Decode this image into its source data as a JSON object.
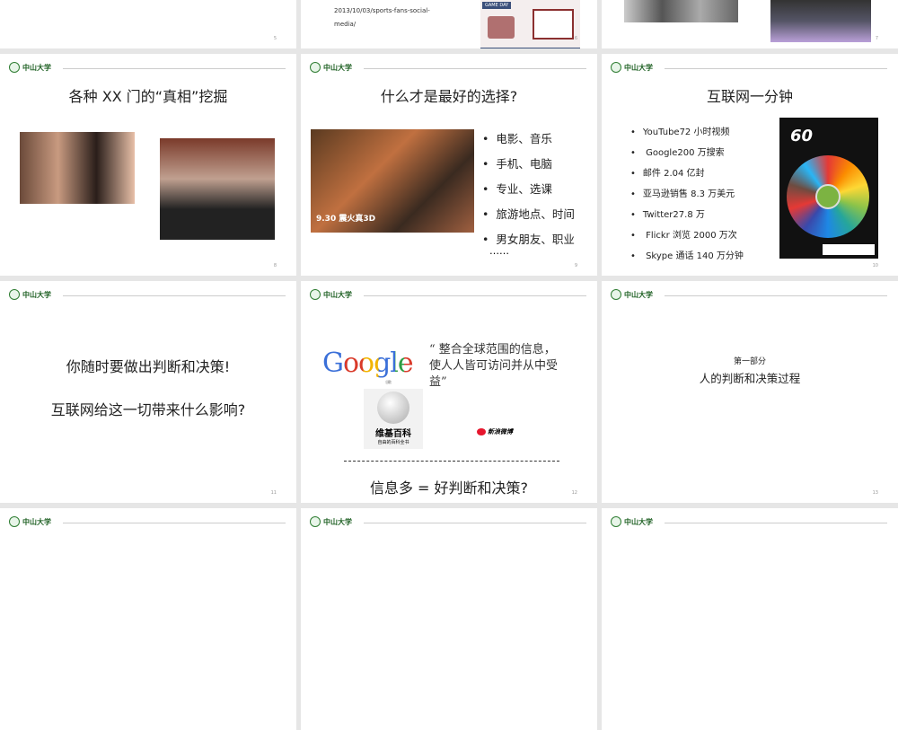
{
  "slides": [
    {
      "num": "5"
    },
    {
      "num": "6",
      "text_lines": [
        "2013/10/03/sports-fans-social-",
        "media/"
      ],
      "image_label": "GAME DAY"
    },
    {
      "num": "7"
    },
    {
      "num": "8",
      "title": "各种 XX 门的“真相”挖掘",
      "logo": "中山大学"
    },
    {
      "num": "9",
      "title": "什么才是最好的选择?",
      "logo": "中山大学",
      "bullets": [
        "电影、音乐",
        "手机、电脑",
        "专业、选课",
        "旅游地点、时间",
        "男女朋友、职业"
      ],
      "ellipsis": "……",
      "poster_text": "9.30 震火真3D"
    },
    {
      "num": "10",
      "title": "互联网一分钟",
      "logo": "中山大学",
      "bullets": [
        "YouTube72 小时视频",
        " Google200 万搜索",
        "邮件 2.04 亿封",
        "亚马逊销售 8.3 万美元",
        "Twitter27.8 万",
        " Flickr 浏览 2000 万次",
        " Skype 通话 140 万分钟"
      ],
      "infographic_title": "60"
    },
    {
      "num": "11",
      "logo": "中山大学",
      "lines": [
        "你随时要做出判断和决策!",
        "互联网给这一切带来什么影响?"
      ]
    },
    {
      "num": "12",
      "logo": "中山大学",
      "quote": "“ 整合全球范围的信息，使人人皆可访问并从中受益”",
      "google": "Google",
      "google_sub": "谷歌",
      "wiki": "维基百科",
      "wiki_sub": "自由的百科全书",
      "weibo": "新浪微博",
      "bottom": "信息多 = 好判断和决策?"
    },
    {
      "num": "13",
      "logo": "中山大学",
      "part": "第一部分",
      "subtitle": "人的判断和决策过程"
    }
  ],
  "row4_logo": "中山大学"
}
